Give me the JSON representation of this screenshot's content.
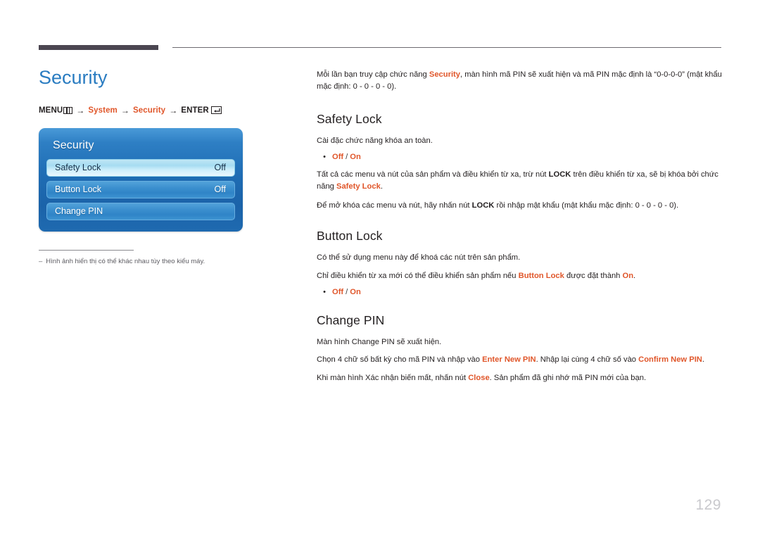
{
  "page": {
    "number": "129"
  },
  "left": {
    "title": "Security",
    "breadcrumb": {
      "menu_label": "MENU",
      "menu_icon": "menu-grid-icon",
      "arrow": "→",
      "step1": "System",
      "step2": "Security",
      "enter_label": "ENTER",
      "enter_icon": "enter-key-icon"
    },
    "osd": {
      "title": "Security",
      "rows": [
        {
          "label": "Safety Lock",
          "value": "Off",
          "selected": true
        },
        {
          "label": "Button Lock",
          "value": "Off",
          "selected": false
        },
        {
          "label": "Change PIN",
          "value": "",
          "selected": false
        }
      ]
    },
    "note": {
      "dash": "–",
      "text": "Hình ảnh hiển thị có thể khác nhau tùy theo kiểu máy."
    }
  },
  "right": {
    "intro": {
      "part1": "Mỗi lần bạn truy cập chức năng ",
      "highlight": "Security",
      "part2": ", màn hình mã PIN sẽ xuất hiện và mã PIN mặc định là “0-0-0-0” (mật khẩu mặc định: 0 - 0 - 0 - 0)."
    },
    "sections": [
      {
        "heading": "Safety Lock",
        "line1": "Cài đặc chức năng khóa an toàn.",
        "bullet": {
          "opt1": "Off",
          "slash": "/",
          "opt2": "On"
        },
        "line2_a": "Tất cả các menu và nút của sản phẩm và điều khiển từ xa, trừ nút ",
        "line2_b": "LOCK",
        "line2_c": " trên điều khiển từ xa, sẽ bị khóa bởi chức năng ",
        "line2_d": "Safety Lock",
        "line2_e": ".",
        "line3_a": "Để mở khóa các menu và nút, hãy nhấn nút ",
        "line3_b": "LOCK",
        "line3_c": " rồi nhập mật khẩu (mật khẩu mặc định: 0 - 0 - 0 - 0)."
      },
      {
        "heading": "Button Lock",
        "line1": "Có thể sử dụng menu này để khoá các nút trên sản phẩm.",
        "line2_a": "Chỉ điều khiển từ xa mới có thể điều khiển sản phẩm nếu ",
        "line2_b": "Button Lock",
        "line2_c": " được đặt thành ",
        "line2_d": "On",
        "line2_e": ".",
        "bullet": {
          "opt1": "Off",
          "slash": "/",
          "opt2": "On"
        }
      },
      {
        "heading": "Change PIN",
        "line1": "Màn hình Change PIN sẽ xuất hiện.",
        "line2_a": "Chọn 4 chữ số bất kỳ cho mã PIN và nhập vào ",
        "line2_b": "Enter New PIN",
        "line2_c": ". Nhập lại cùng 4 chữ số vào ",
        "line2_d": "Confirm New PIN",
        "line2_e": ".",
        "line3_a": "Khi màn hình Xác nhận biến mất, nhấn nút ",
        "line3_b": "Close",
        "line3_c": ". Sản phẩm đã ghi nhớ mã PIN mới của bạn."
      }
    ]
  },
  "colors": {
    "accent_blue": "#2a7cc1",
    "accent_orange": "#e0562a",
    "rule_dark": "#4b4651",
    "osd_blue": "#1f6db4"
  }
}
